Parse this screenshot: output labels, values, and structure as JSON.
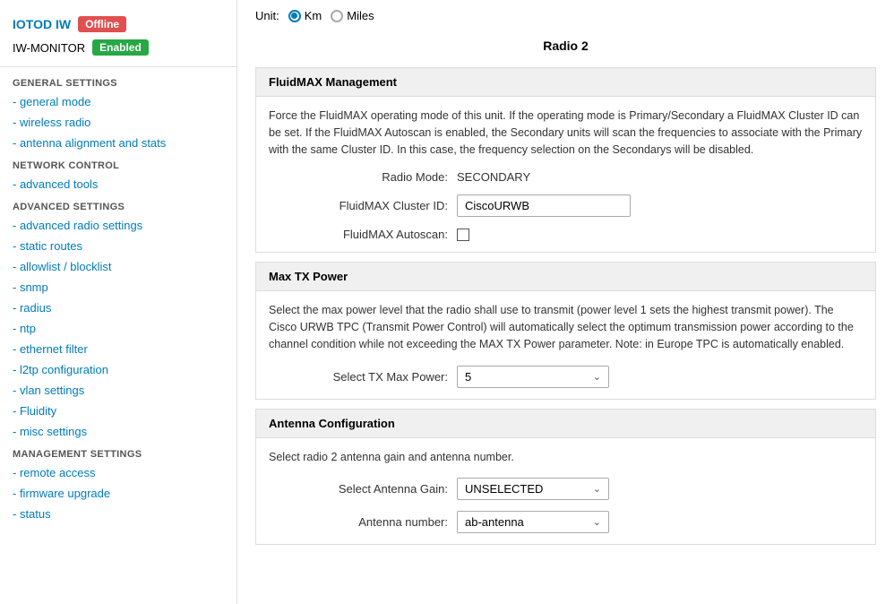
{
  "sidebar": {
    "app_name": "IOTOD IW",
    "app_name2": "IW-MONITOR",
    "badge_offline": "Offline",
    "badge_enabled": "Enabled",
    "general_settings_label": "GENERAL SETTINGS",
    "network_control_label": "NETWORK CONTROL",
    "advanced_settings_label": "ADVANCED SETTINGS",
    "management_settings_label": "MANAGEMENT SETTINGS",
    "nav_items_general": [
      {
        "label": "- general mode",
        "name": "nav-general-mode"
      },
      {
        "label": "- wireless radio",
        "name": "nav-wireless-radio"
      },
      {
        "label": "- antenna alignment and stats",
        "name": "nav-antenna-alignment"
      }
    ],
    "nav_items_network": [
      {
        "label": "- advanced tools",
        "name": "nav-advanced-tools"
      }
    ],
    "nav_items_advanced": [
      {
        "label": "- advanced radio settings",
        "name": "nav-advanced-radio"
      },
      {
        "label": "- static routes",
        "name": "nav-static-routes"
      },
      {
        "label": "- allowlist / blocklist",
        "name": "nav-allowlist"
      },
      {
        "label": "- snmp",
        "name": "nav-snmp"
      },
      {
        "label": "- radius",
        "name": "nav-radius"
      },
      {
        "label": "- ntp",
        "name": "nav-ntp"
      },
      {
        "label": "- ethernet filter",
        "name": "nav-ethernet-filter"
      },
      {
        "label": "- l2tp configuration",
        "name": "nav-l2tp"
      },
      {
        "label": "- vlan settings",
        "name": "nav-vlan"
      },
      {
        "label": "- Fluidity",
        "name": "nav-fluidity"
      },
      {
        "label": "- misc settings",
        "name": "nav-misc"
      }
    ],
    "nav_items_management": [
      {
        "label": "- remote access",
        "name": "nav-remote-access"
      },
      {
        "label": "- firmware upgrade",
        "name": "nav-firmware-upgrade"
      },
      {
        "label": "- status",
        "name": "nav-status"
      }
    ]
  },
  "main": {
    "unit_label": "Unit:",
    "km_label": "Km",
    "miles_label": "Miles",
    "radio2_title": "Radio 2",
    "fluidmax_section_title": "FluidMAX Management",
    "fluidmax_description": "Force the FluidMAX operating mode of this unit. If the operating mode is Primary/Secondary a FluidMAX Cluster ID can be set. If the FluidMAX Autoscan is enabled, the Secondary units will scan the frequencies to associate with the Primary with the same Cluster ID. In this case, the frequency selection on the Secondarys will be disabled.",
    "radio_mode_label": "Radio Mode:",
    "radio_mode_value": "SECONDARY",
    "fluidmax_cluster_label": "FluidMAX Cluster ID:",
    "fluidmax_cluster_value": "CiscoURWB",
    "fluidmax_autoscan_label": "FluidMAX Autoscan:",
    "max_tx_section_title": "Max TX Power",
    "max_tx_description": "Select the max power level that the radio shall use to transmit (power level 1 sets the highest transmit power). The Cisco URWB TPC (Transmit Power Control) will automatically select the optimum transmission power according to the channel condition while not exceeding the MAX TX Power parameter. Note: in Europe TPC is automatically enabled.",
    "tx_max_power_label": "Select TX Max Power:",
    "tx_max_power_value": "5",
    "antenna_section_title": "Antenna Configuration",
    "antenna_description": "Select radio 2 antenna gain and antenna number.",
    "antenna_gain_label": "Select Antenna Gain:",
    "antenna_gain_value": "UNSELECTED",
    "antenna_number_label": "Antenna number:",
    "antenna_number_value": "ab-antenna"
  }
}
